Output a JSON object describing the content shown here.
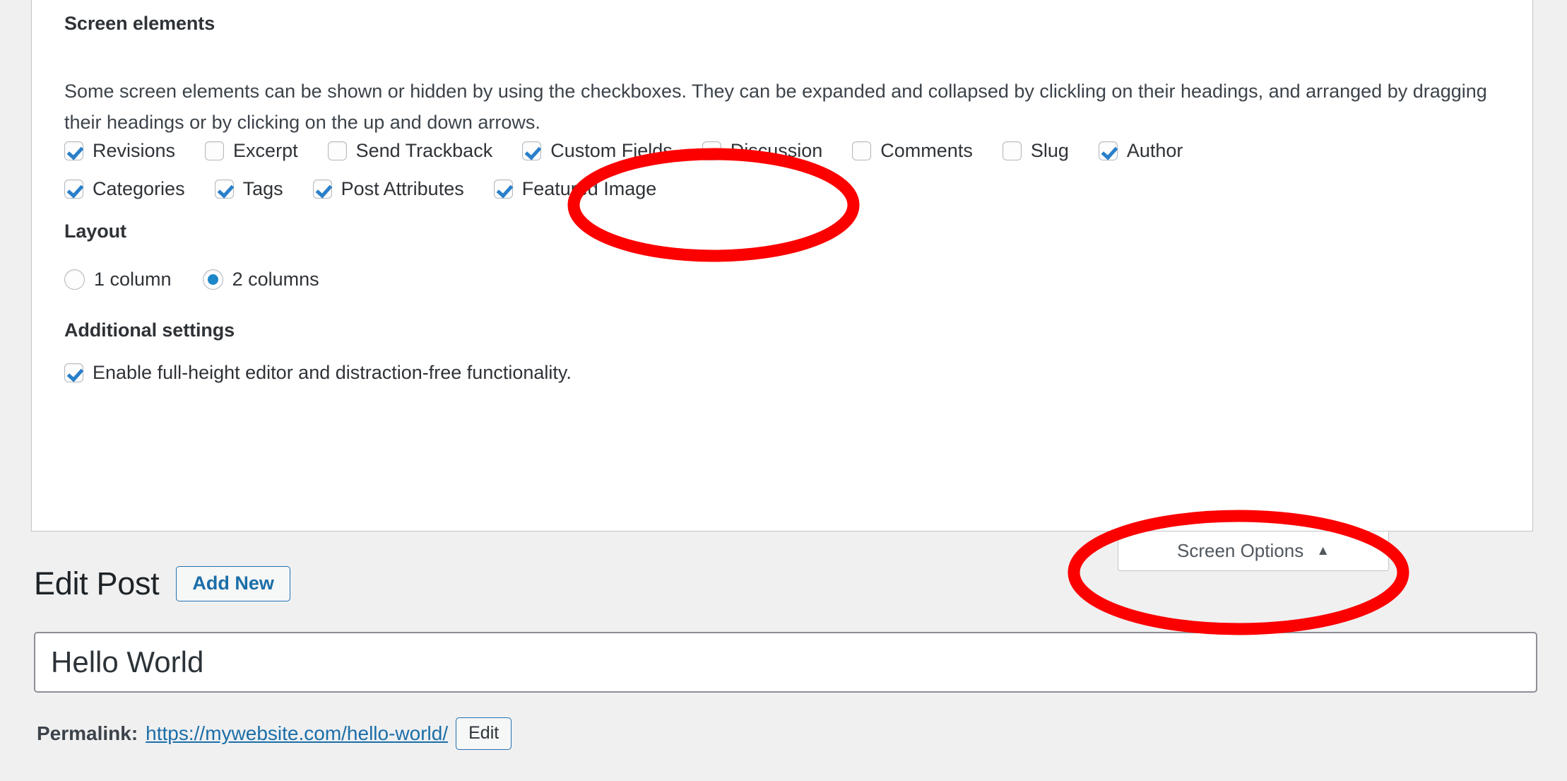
{
  "panel": {
    "section_title": "Screen elements",
    "intro_text": "Some screen elements can be shown or hidden by using the checkboxes. They can be expanded and collapsed by clickling on their headings, and arranged by dragging their headings or by clicking on the up and down arrows.",
    "screen_elements_row1": [
      {
        "label": "Revisions",
        "checked": true
      },
      {
        "label": "Excerpt",
        "checked": false
      },
      {
        "label": "Send Trackback",
        "checked": false
      },
      {
        "label": "Custom Fields",
        "checked": true
      },
      {
        "label": "Discussion",
        "checked": false
      },
      {
        "label": "Comments",
        "checked": false
      },
      {
        "label": "Slug",
        "checked": false
      },
      {
        "label": "Author",
        "checked": true
      }
    ],
    "screen_elements_row2": [
      {
        "label": "Categories",
        "checked": true
      },
      {
        "label": "Tags",
        "checked": true
      },
      {
        "label": "Post Attributes",
        "checked": true
      },
      {
        "label": "Featured Image",
        "checked": true
      }
    ],
    "layout_title": "Layout",
    "layout_options": [
      {
        "label": "1 column",
        "selected": false
      },
      {
        "label": "2 columns",
        "selected": true
      }
    ],
    "additional_title": "Additional settings",
    "additional_options": [
      {
        "label": "Enable full-height editor and distraction-free functionality.",
        "checked": true
      }
    ]
  },
  "screen_options_button": {
    "label": "Screen Options",
    "caret": "▲"
  },
  "page": {
    "title": "Edit Post",
    "add_new_label": "Add New",
    "post_title_value": "Hello World",
    "permalink_label": "Permalink:",
    "permalink_url": "https://mywebsite.com/hello-world/",
    "permalink_edit_label": "Edit"
  },
  "annotations": {
    "accent_color": "#fc0000",
    "highlighted": [
      "Custom Fields",
      "Screen Options"
    ]
  }
}
